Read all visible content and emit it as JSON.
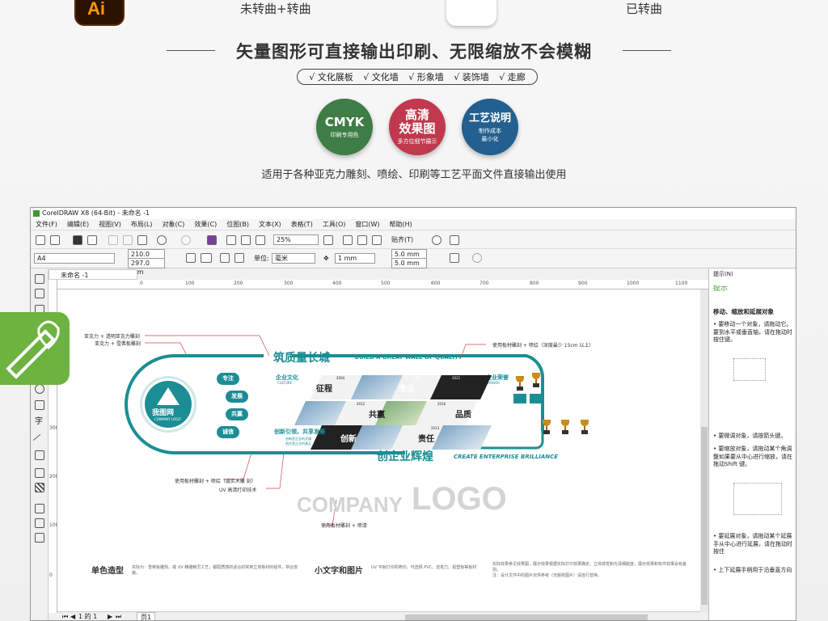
{
  "top": {
    "left_caption": "未转曲+转曲",
    "right_caption": "已转曲",
    "ai_icon_text": "Ai",
    "headline": "矢量图形可直接输出印刷、无限缩放不会模糊",
    "tags": [
      "√ 文化展板",
      "√ 文化墙",
      "√ 形象墙",
      "√ 装饰墙",
      "√ 走廊"
    ],
    "circles": [
      {
        "big": "CMYK",
        "small": "印刷专用色",
        "color": "#3e7d45"
      },
      {
        "big": "高清\n效果图",
        "small": "多方位细节展示",
        "color": "#c0394d"
      },
      {
        "big": "工艺说明",
        "small": "制作成本\n最小化",
        "color": "#23608f"
      }
    ],
    "caption": "适用于各种亚克力雕刻、喷绘、印刷等工艺平面文件直接输出使用"
  },
  "window": {
    "title": "CorelDRAW X8 (64-Bit) - 未命名 -1",
    "menu": [
      "文件(F)",
      "编辑(E)",
      "视图(V)",
      "布局(L)",
      "对象(C)",
      "效果(C)",
      "位图(B)",
      "文本(X)",
      "表格(T)",
      "工具(O)",
      "窗口(W)",
      "帮助(H)"
    ],
    "zoom": "25%",
    "snap_label": "贴齐(T)",
    "paper": "A4",
    "width": "210.0 mm",
    "height": "297.0 mm",
    "units_label": "单位:",
    "units": "毫米",
    "nudge": "1 mm",
    "dup_x": "5.0 mm",
    "dup_y": "5.0 mm",
    "doc_tab": "未命名 -1",
    "ruler": [
      "0",
      "100",
      "200",
      "300",
      "400",
      "500",
      "600",
      "700",
      "800",
      "900",
      "1000",
      "1100"
    ],
    "vruler": [
      "300",
      "200",
      "100",
      "0"
    ],
    "page_nav": "1 的 1",
    "page_tab": "页1"
  },
  "panel": {
    "header": "提示(N)",
    "title": "提示",
    "subtitle": "移动、缩放和延展对象",
    "p1": "• 要移动一个对象，请拖动它。要到水平或垂直轴，请在拖动时按住键。",
    "p2": "• 要微调对象，请按箭头键。",
    "p3": "• 要缩放对象，请拖动某个角调整如果要从中心进行缩放，请在拖动Shift 键。",
    "p4": "• 要延展对象，请拖动某个延展手从中心进行延展，请在拖动时按住",
    "p5": "• 上下延展手柄用于沿垂直方向"
  },
  "design": {
    "title_cn": "筑质量长城",
    "title_en": "BUILD A GREAT WALL OF QUALITY",
    "sub_cn": "创企业辉煌",
    "sub_en": "CREATE ENTERPRISE BRILLIANCE",
    "logo_cn": "我图网",
    "logo_en": "COMPANY LOGO",
    "seals": [
      "专注",
      "发展",
      "共赢",
      "诚信"
    ],
    "culture_cn": "企业文化",
    "culture_en": "CULTURE",
    "honor_cn": "企业荣誉",
    "honor_en": "HONOR",
    "slogan": "创新引领，共享发展",
    "slogan_sub": "创新是企业的灵魂\n责任是企业的基石",
    "words": [
      "征程",
      "专业",
      "共赢",
      "品质",
      "创新",
      "责任"
    ],
    "years": [
      "2004",
      "2008",
      "2012",
      "2016",
      "2021",
      "2013"
    ],
    "ann_l1": "亚克力 + 透明亚克力雕刻",
    "ann_l2": "亚克力 + 雪弗板雕刻",
    "ann_r1": "使用板材雕刻 + 喷绘（深度最少 15cm 以上）",
    "ann_b1": "使用板材雕刻 + 喷绘（或实木雕 刻）",
    "ann_b2": "UV 高清打印技术",
    "ann_b3": "使用板材雕刻 + 喷漆",
    "company": "COMPANY",
    "logo_word": "LOGO",
    "foot1_t": "单色造型",
    "foot1_s": "实际为：雪弗板雕刻，或 UV 精雕精灵工艺，都配质感的适合的常用立体板材的组件，拼合安装。",
    "foot2_t": "小文字和图片",
    "foot2_s": "UV 平板打印机喷印，可选择 PVC、亚克力、铝塑板等板材",
    "foot3_s": "实际效果参见效果图，展示效果根据实际打印效果确定，立体感觉和光泽细腻度，展示效果和软件效果会有差别。\n注：设计文件中的图片仅供参考（无版权图片）请自行替换。"
  }
}
